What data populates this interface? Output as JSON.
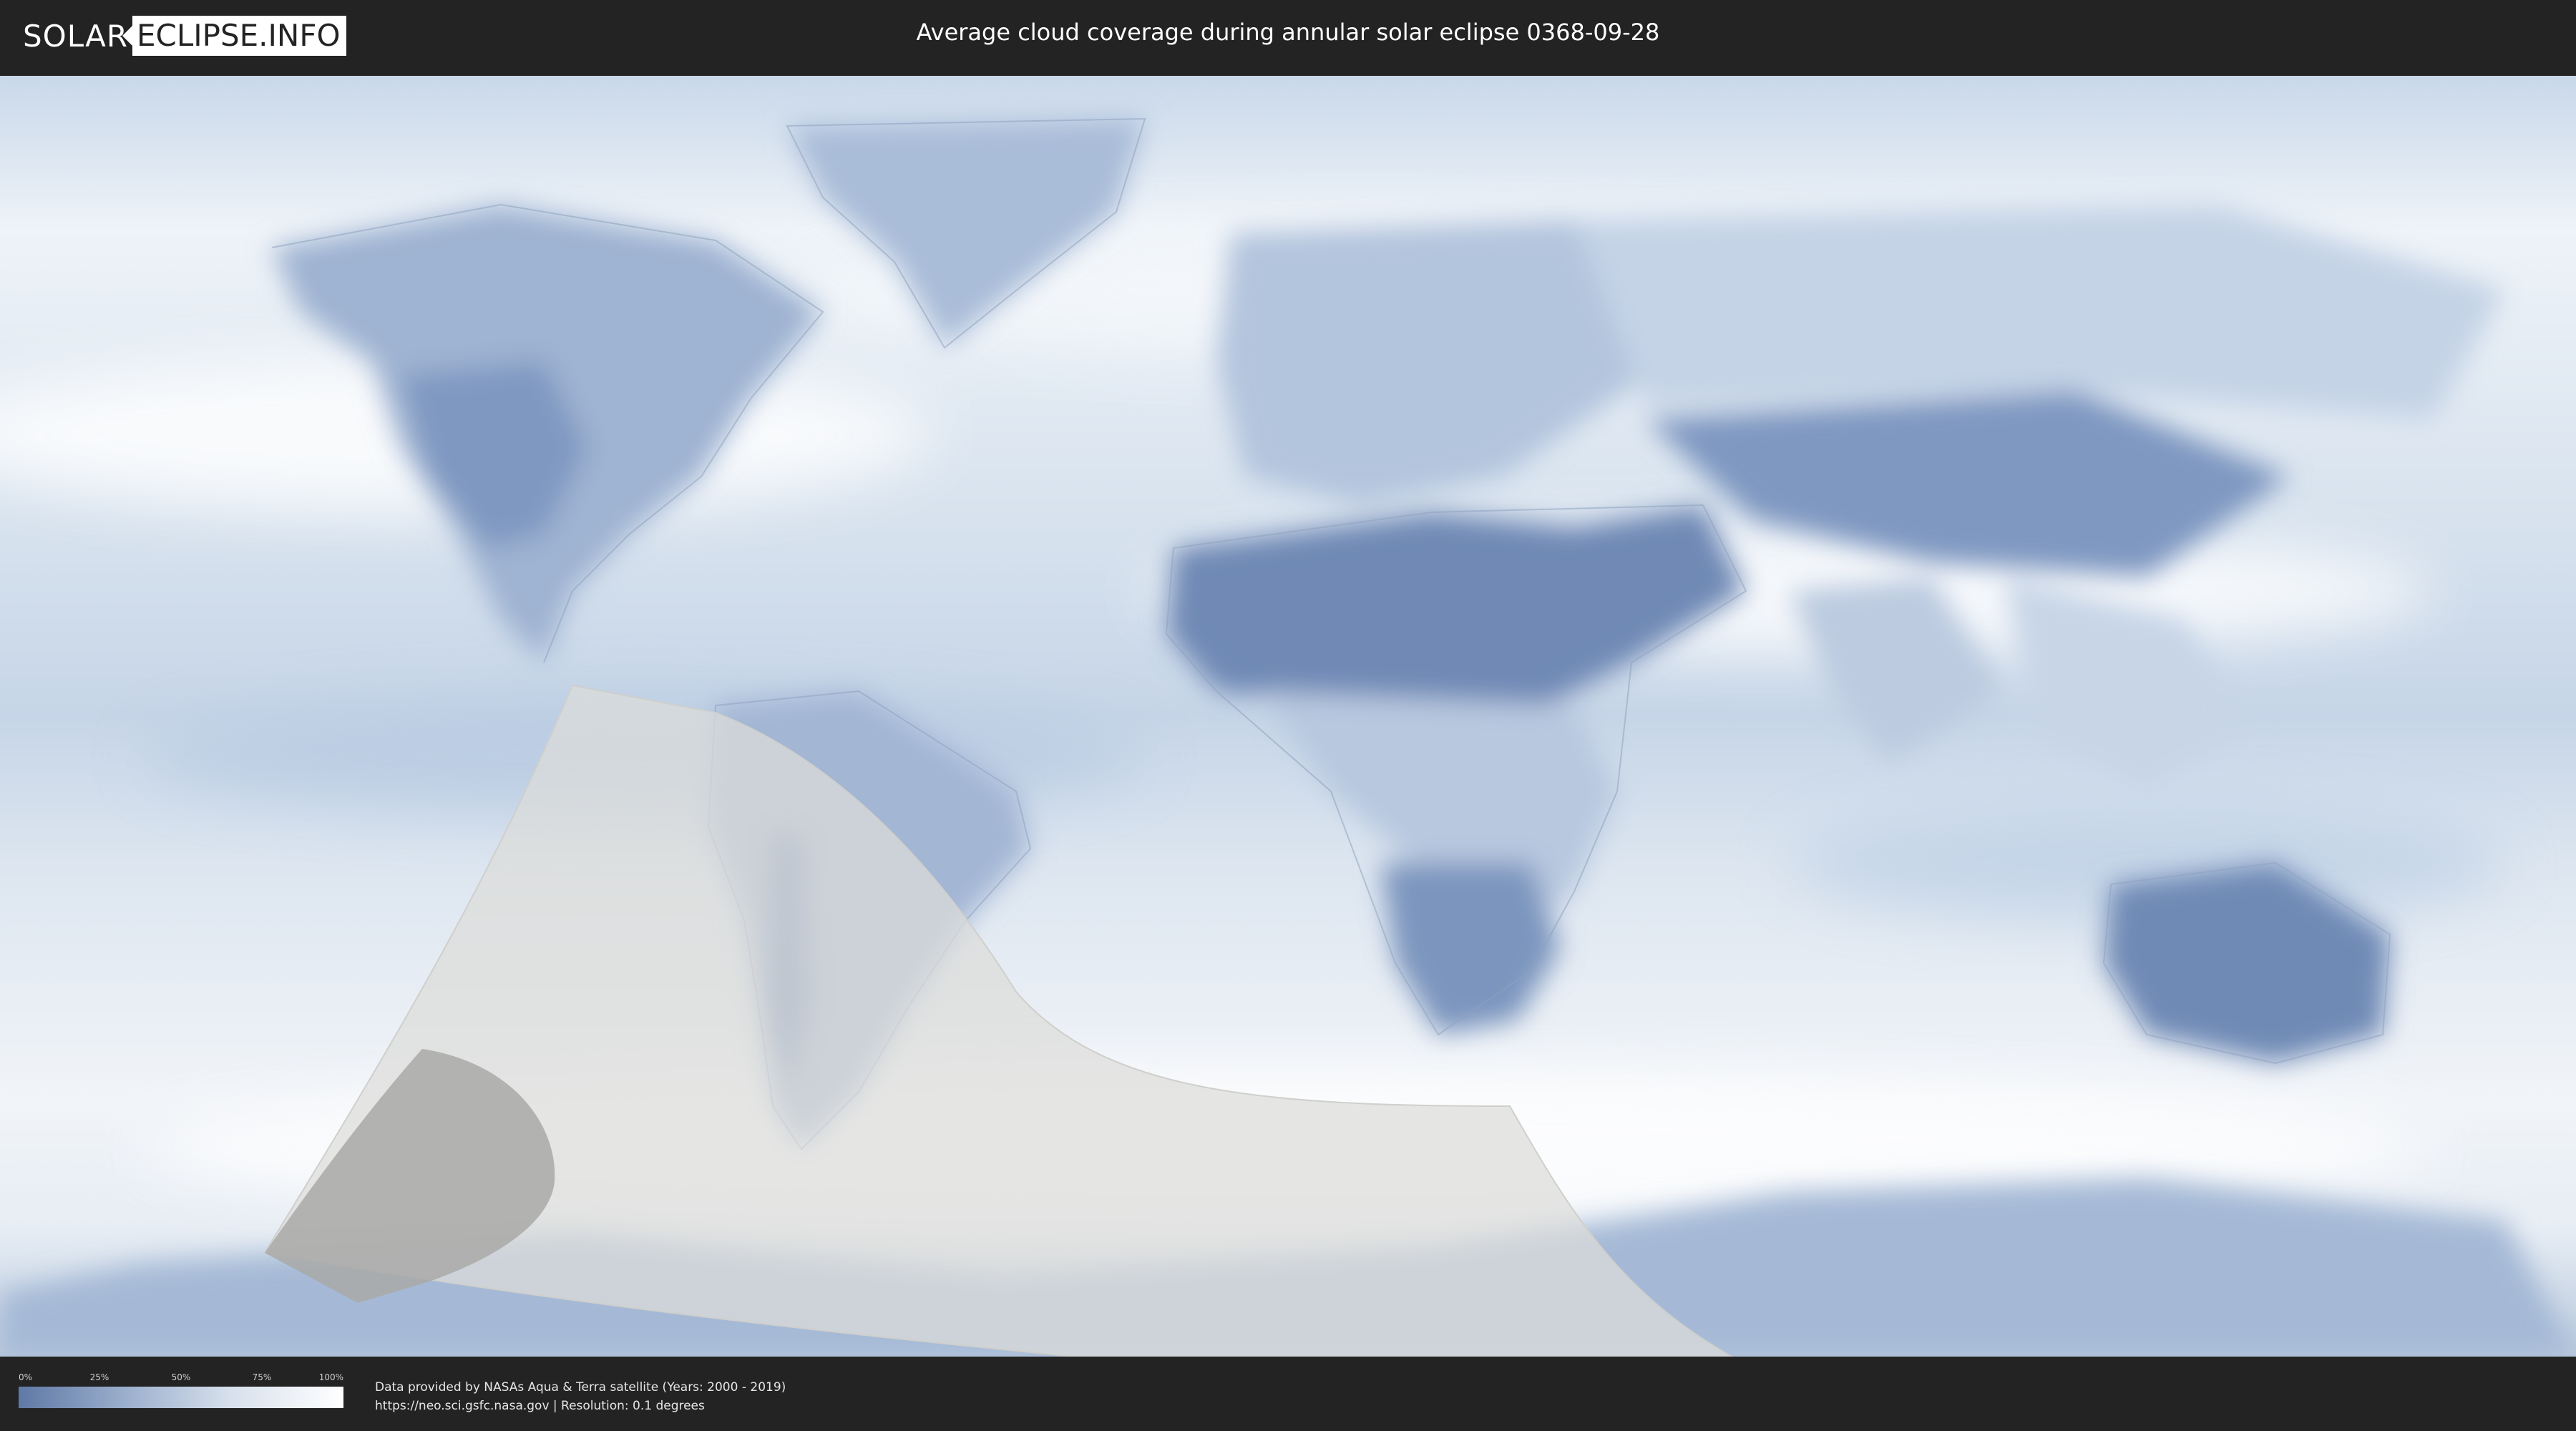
{
  "header": {
    "logo_left": "SOLAR",
    "logo_right": "ECLIPSE.INFO",
    "title": "Average cloud coverage during annular solar eclipse 0368-09-28"
  },
  "legend": {
    "ticks": [
      "0%",
      "25%",
      "50%",
      "75%",
      "100%"
    ],
    "tick_fractions": [
      0,
      0.25,
      0.5,
      0.75,
      1.0
    ],
    "color_low": "#5f79a6",
    "color_high": "#ffffff"
  },
  "credits": {
    "line1": "Data provided by NASAs Aqua & Terra satellite (Years: 2000 - 2019)",
    "line2": "https://neo.sci.gsfc.nasa.gov | Resolution: 0.1 degrees"
  },
  "colors": {
    "background": "#232323",
    "ocean_clouds": "#dfe8f1",
    "land_clear": "#7d95bd",
    "eclipse_zone": "#d6d6d4",
    "eclipse_core": "#a8a8a6"
  }
}
